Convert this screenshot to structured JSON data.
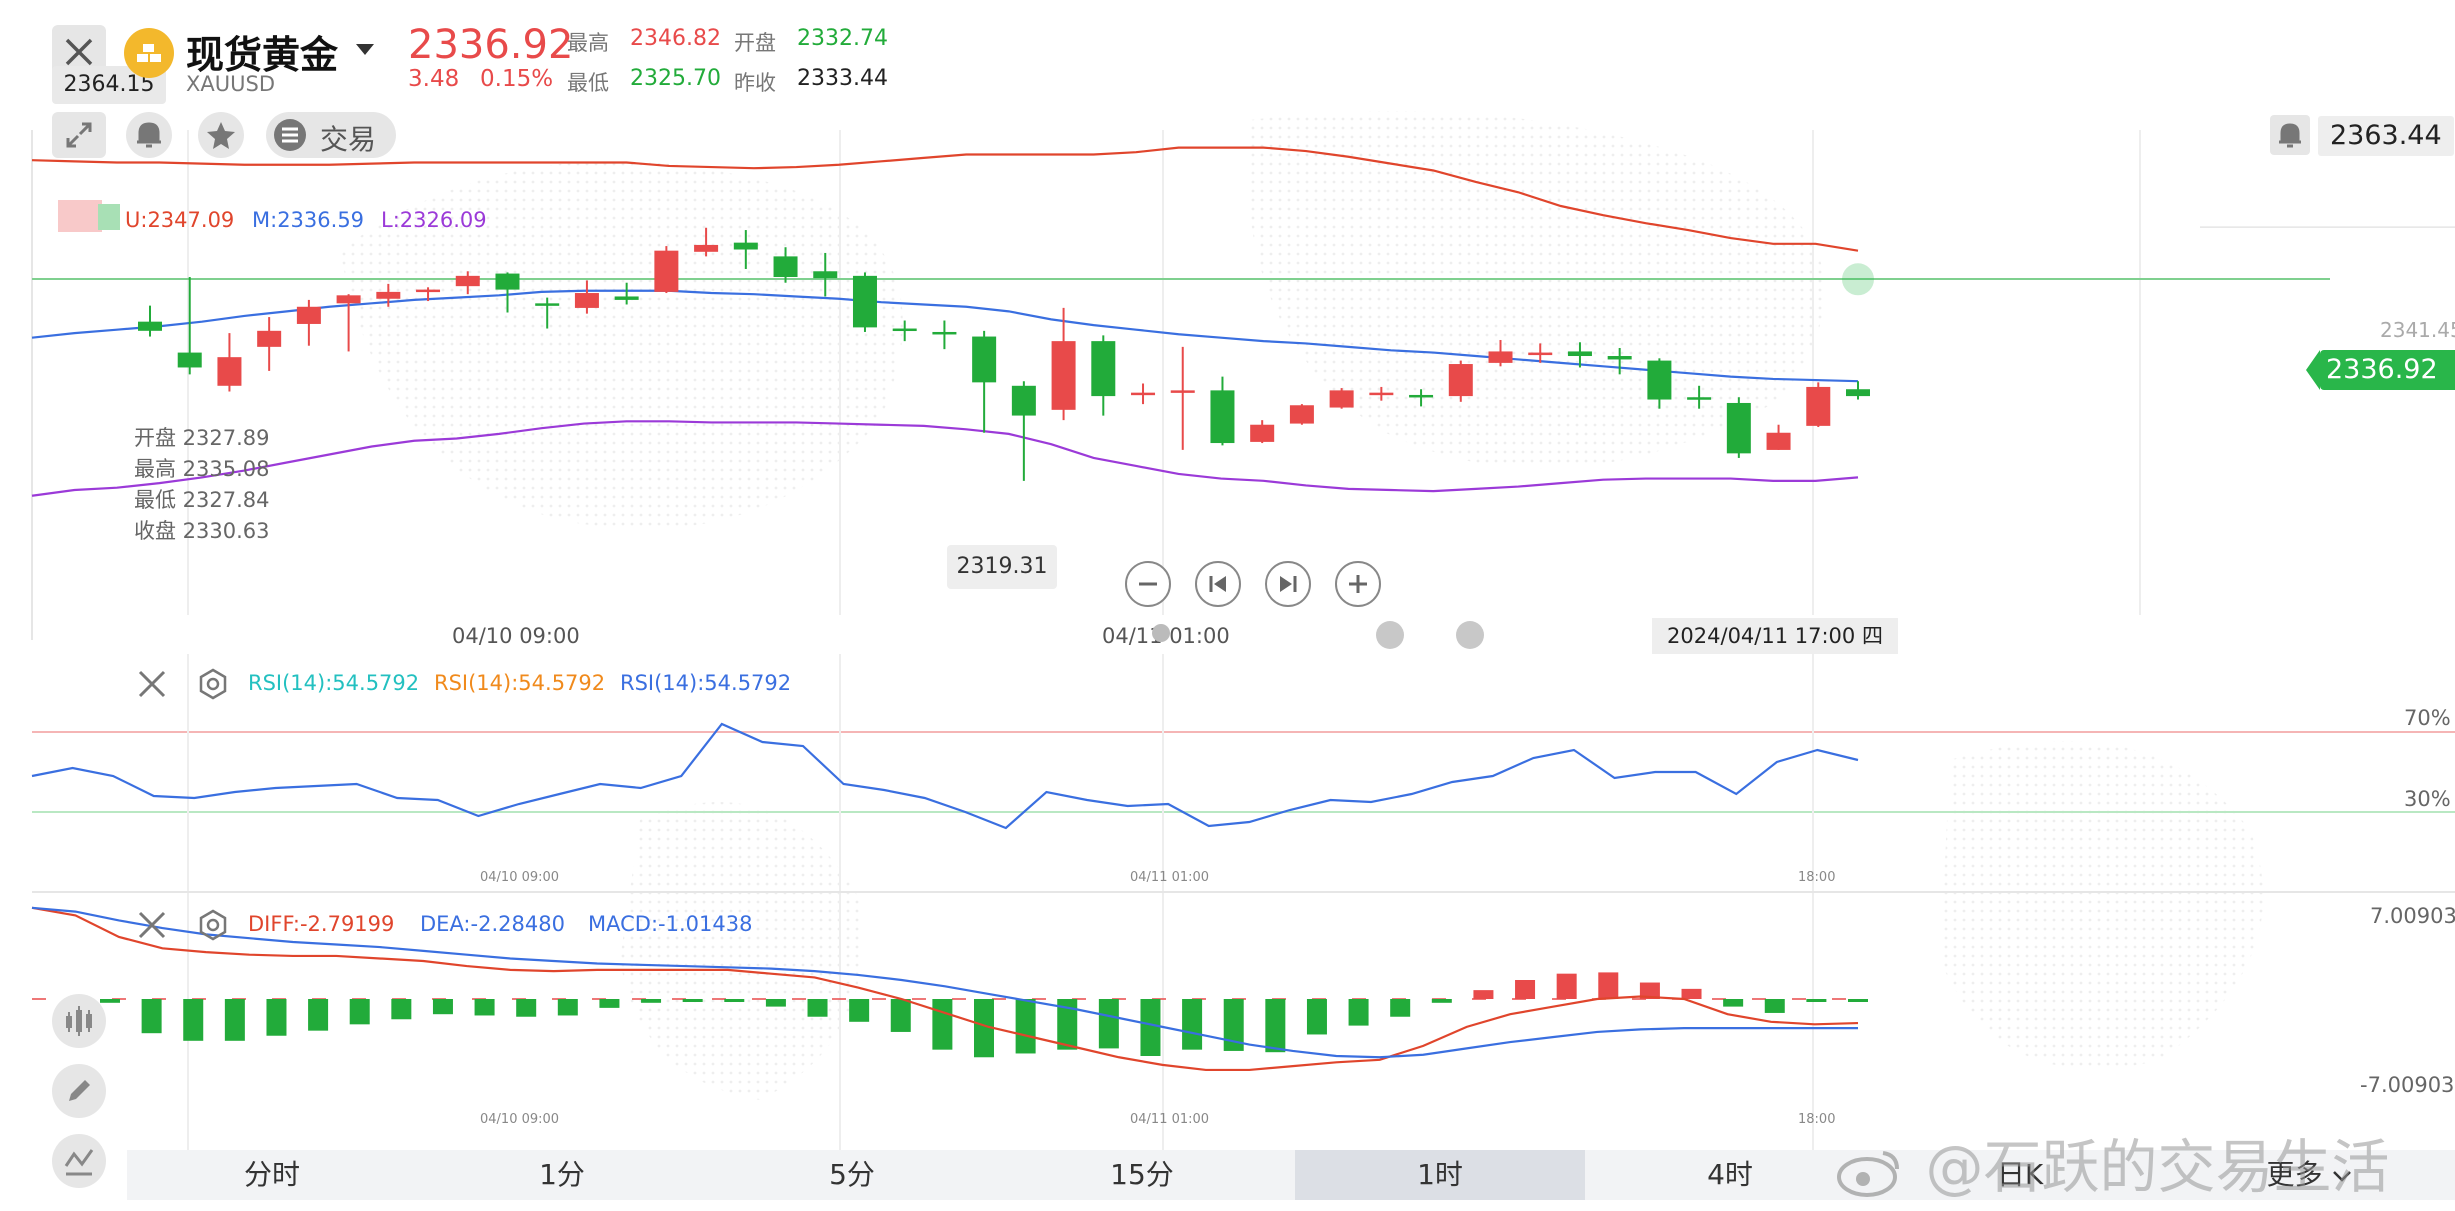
{
  "header": {
    "title": "现货黄金",
    "symbol": "XAUUSD",
    "price": "2336.92",
    "change": "3.48",
    "change_pct": "0.15%",
    "high_label": "最高",
    "high_value": "2346.82",
    "open_label": "开盘",
    "open_value": "2332.74",
    "low_label": "最低",
    "low_value": "2325.70",
    "prev_close_label": "昨收",
    "prev_close_value": "2333.44",
    "trade_label": "交易",
    "close_icon": "close-icon",
    "logo_icon": "gold-bars-icon",
    "dropdown_icon": "caret-down-icon"
  },
  "main_chart": {
    "top_price_tag": "2364.15",
    "alert_price": "2363.44",
    "current_price_tag": "2336.92",
    "right_axis_label": "2341.45",
    "low_marker": "2319.31",
    "boll": {
      "upper": "U:2347.09",
      "middle": "M:2336.59",
      "lower": "L:2326.09"
    },
    "ohlc_popup": {
      "open": "开盘 2327.89",
      "high": "最高 2335.08",
      "low": "最低 2327.84",
      "close": "收盘 2330.63"
    },
    "time_labels": [
      "04/10 09:00",
      "04/11 01:00"
    ],
    "crosshair_time": "2024/04/11 17:00 四",
    "colors": {
      "up": "#e84a4a",
      "down": "#22ab3a",
      "upper": "#e0452c",
      "middle": "#3a6fe0",
      "lower": "#9b3ad8"
    }
  },
  "rsi_panel": {
    "rsi1": "RSI(14):54.5792",
    "rsi2": "RSI(14):54.5792",
    "rsi3": "RSI(14):54.5792",
    "level_70": "70%",
    "level_30": "30%",
    "time_labels": [
      "04/10 09:00",
      "04/11 01:00",
      "18:00"
    ]
  },
  "macd_panel": {
    "diff": "DIFF:-2.79199",
    "dea": "DEA:-2.28480",
    "macd": "MACD:-1.01438",
    "axis_top": "7.00903",
    "axis_bottom": "-7.00903",
    "time_labels": [
      "04/10 09:00",
      "04/11 01:00",
      "18:00"
    ]
  },
  "tabs": [
    "分时",
    "1分",
    "5分",
    "15分",
    "1时",
    "4时",
    "日K",
    "更多"
  ],
  "active_tab": "1时",
  "watermark": "@石跃的交易生活",
  "chart_data": {
    "type": "candlestick",
    "candles": [
      {
        "o": 2333.2,
        "h": 2334.6,
        "c": 2332.4,
        "l": 2331.9
      },
      {
        "o": 2330.5,
        "h": 2337.1,
        "c": 2329.2,
        "l": 2328.6
      },
      {
        "o": 2327.6,
        "h": 2332.2,
        "c": 2330.1,
        "l": 2327.1
      },
      {
        "o": 2331.0,
        "h": 2333.6,
        "c": 2332.4,
        "l": 2328.9
      },
      {
        "o": 2333.0,
        "h": 2335.1,
        "c": 2334.5,
        "l": 2331.1
      },
      {
        "o": 2334.8,
        "h": 2335.6,
        "c": 2335.5,
        "l": 2330.6
      },
      {
        "o": 2335.2,
        "h": 2336.5,
        "c": 2335.8,
        "l": 2334.5
      },
      {
        "o": 2335.9,
        "h": 2336.2,
        "c": 2336.0,
        "l": 2335.0
      },
      {
        "o": 2336.3,
        "h": 2337.6,
        "c": 2337.2,
        "l": 2335.6
      },
      {
        "o": 2337.4,
        "h": 2337.5,
        "c": 2336.0,
        "l": 2334.0
      },
      {
        "o": 2334.8,
        "h": 2335.3,
        "c": 2334.7,
        "l": 2332.6
      },
      {
        "o": 2334.4,
        "h": 2336.8,
        "c": 2335.7,
        "l": 2333.9
      },
      {
        "o": 2335.4,
        "h": 2336.6,
        "c": 2335.1,
        "l": 2334.7
      },
      {
        "o": 2335.8,
        "h": 2339.8,
        "c": 2339.4,
        "l": 2335.7
      },
      {
        "o": 2339.3,
        "h": 2341.4,
        "c": 2339.9,
        "l": 2338.9
      },
      {
        "o": 2340.1,
        "h": 2341.2,
        "c": 2339.5,
        "l": 2337.8
      },
      {
        "o": 2338.9,
        "h": 2339.7,
        "c": 2337.1,
        "l": 2336.6
      },
      {
        "o": 2337.6,
        "h": 2339.2,
        "c": 2337.0,
        "l": 2335.4
      },
      {
        "o": 2337.2,
        "h": 2337.5,
        "c": 2332.7,
        "l": 2332.3
      },
      {
        "o": 2332.6,
        "h": 2333.3,
        "c": 2332.5,
        "l": 2331.5
      },
      {
        "o": 2332.3,
        "h": 2333.3,
        "c": 2332.1,
        "l": 2330.8
      },
      {
        "o": 2331.9,
        "h": 2332.4,
        "c": 2327.9,
        "l": 2323.5
      },
      {
        "o": 2327.6,
        "h": 2328.0,
        "c": 2325.0,
        "l": 2319.3
      },
      {
        "o": 2325.5,
        "h": 2334.4,
        "c": 2331.5,
        "l": 2324.6
      },
      {
        "o": 2331.5,
        "h": 2332.0,
        "c": 2326.7,
        "l": 2325.0
      },
      {
        "o": 2327.0,
        "h": 2327.8,
        "c": 2327.0,
        "l": 2326.0
      },
      {
        "o": 2327.0,
        "h": 2331.0,
        "c": 2327.2,
        "l": 2322.0
      },
      {
        "o": 2327.2,
        "h": 2328.4,
        "c": 2322.6,
        "l": 2322.4
      },
      {
        "o": 2322.7,
        "h": 2324.6,
        "c": 2324.2,
        "l": 2322.6
      },
      {
        "o": 2324.3,
        "h": 2326.0,
        "c": 2325.9,
        "l": 2324.2
      },
      {
        "o": 2325.7,
        "h": 2327.4,
        "c": 2327.2,
        "l": 2325.6
      },
      {
        "o": 2327.0,
        "h": 2327.5,
        "c": 2327.0,
        "l": 2326.3
      },
      {
        "o": 2326.8,
        "h": 2327.3,
        "c": 2326.7,
        "l": 2325.8
      },
      {
        "o": 2326.7,
        "h": 2329.8,
        "c": 2329.5,
        "l": 2326.2
      },
      {
        "o": 2329.6,
        "h": 2331.6,
        "c": 2330.6,
        "l": 2329.3
      },
      {
        "o": 2330.4,
        "h": 2331.3,
        "c": 2330.5,
        "l": 2329.6
      },
      {
        "o": 2330.6,
        "h": 2331.4,
        "c": 2330.2,
        "l": 2329.2
      },
      {
        "o": 2330.2,
        "h": 2330.9,
        "c": 2329.9,
        "l": 2328.6
      },
      {
        "o": 2329.8,
        "h": 2330.0,
        "c": 2326.4,
        "l": 2325.6
      },
      {
        "o": 2326.6,
        "h": 2327.6,
        "c": 2326.4,
        "l": 2325.6
      },
      {
        "o": 2326.1,
        "h": 2326.6,
        "c": 2321.7,
        "l": 2321.3
      },
      {
        "o": 2322.0,
        "h": 2324.2,
        "c": 2323.5,
        "l": 2322.0
      },
      {
        "o": 2324.1,
        "h": 2327.9,
        "c": 2327.5,
        "l": 2324.0
      },
      {
        "o": 2327.3,
        "h": 2328.0,
        "c": 2326.7,
        "l": 2326.4
      }
    ],
    "boll_upper": [
      2347.3,
      2347.2,
      2347.1,
      2347.1,
      2347.0,
      2346.9,
      2346.9,
      2346.9,
      2347.0,
      2347.1,
      2347.1,
      2347.1,
      2347.1,
      2347.1,
      2347.1,
      2346.8,
      2346.7,
      2346.6,
      2346.7,
      2346.9,
      2347.2,
      2347.5,
      2347.8,
      2347.8,
      2347.8,
      2347.8,
      2348.0,
      2348.4,
      2348.4,
      2348.4,
      2348.1,
      2347.6,
      2347.0,
      2346.4,
      2345.4,
      2344.5,
      2343.3,
      2342.5,
      2341.8,
      2341.2,
      2340.5,
      2340.0,
      2340.0,
      2339.4
    ],
    "boll_mid": [
      2331.8,
      2332.2,
      2332.5,
      2332.8,
      2333.2,
      2333.7,
      2334.1,
      2334.5,
      2334.8,
      2335.1,
      2335.3,
      2335.5,
      2335.8,
      2335.9,
      2335.9,
      2335.9,
      2335.7,
      2335.6,
      2335.4,
      2335.2,
      2334.9,
      2334.7,
      2334.5,
      2334.1,
      2333.4,
      2332.9,
      2332.5,
      2332.1,
      2331.8,
      2331.5,
      2331.3,
      2331.0,
      2330.7,
      2330.5,
      2330.2,
      2329.9,
      2329.6,
      2329.3,
      2329.0,
      2328.7,
      2328.4,
      2328.2,
      2328.1,
      2328.0
    ],
    "boll_lower": [
      2318.0,
      2318.5,
      2318.7,
      2319.1,
      2319.6,
      2320.2,
      2320.9,
      2321.6,
      2322.3,
      2322.8,
      2323.0,
      2323.4,
      2323.9,
      2324.3,
      2324.5,
      2324.5,
      2324.4,
      2324.4,
      2324.4,
      2324.3,
      2324.2,
      2324.1,
      2323.8,
      2323.4,
      2322.5,
      2321.3,
      2320.6,
      2319.9,
      2319.5,
      2319.3,
      2318.9,
      2318.6,
      2318.5,
      2318.4,
      2318.6,
      2318.8,
      2319.1,
      2319.4,
      2319.5,
      2319.5,
      2319.5,
      2319.3,
      2319.3,
      2319.6
    ],
    "rsi": [
      48,
      52,
      48,
      38,
      37,
      40,
      42,
      43,
      44,
      37,
      36,
      28,
      34,
      39,
      44,
      42,
      48,
      74,
      65,
      63,
      44,
      41,
      37,
      30,
      22,
      40,
      36,
      33,
      34,
      23,
      25,
      31,
      36,
      35,
      39,
      45,
      48,
      57,
      61,
      47,
      50,
      50,
      39,
      55,
      61,
      56
    ],
    "macd_hist": [
      -0.3,
      -2.7,
      -3.3,
      -3.3,
      -2.9,
      -2.5,
      -2.0,
      -1.6,
      -1.2,
      -1.3,
      -1.4,
      -1.3,
      -0.7,
      -0.3,
      -0.1,
      -0.2,
      -0.6,
      -1.4,
      -1.8,
      -2.6,
      -4.0,
      -4.6,
      -4.3,
      -4.0,
      -3.9,
      -4.5,
      -4.0,
      -4.1,
      -4.2,
      -2.8,
      -2.1,
      -1.4,
      -0.3,
      0.7,
      1.5,
      2.0,
      2.1,
      1.3,
      0.8,
      -0.6,
      -1.1,
      -0.1,
      -0.1
    ],
    "macd_diff": [
      7.2,
      6.6,
      4.9,
      4.0,
      3.7,
      3.5,
      3.4,
      3.4,
      3.2,
      3.0,
      2.6,
      2.3,
      2.2,
      2.3,
      2.3,
      2.3,
      2.3,
      2.0,
      1.7,
      0.9,
      0.0,
      -1.1,
      -2.2,
      -3.0,
      -3.8,
      -4.6,
      -5.2,
      -5.6,
      -5.6,
      -5.3,
      -5.0,
      -4.8,
      -3.7,
      -2.2,
      -1.2,
      -0.6,
      0.0,
      0.2,
      0.0,
      -1.2,
      -1.8,
      -2.0,
      -1.9
    ],
    "macd_dea": [
      7.2,
      6.9,
      6.2,
      5.6,
      5.1,
      4.8,
      4.5,
      4.3,
      4.1,
      3.8,
      3.5,
      3.2,
      3.0,
      2.8,
      2.7,
      2.6,
      2.5,
      2.4,
      2.2,
      1.9,
      1.5,
      1.0,
      0.4,
      -0.2,
      -0.8,
      -1.5,
      -2.2,
      -2.9,
      -3.6,
      -4.1,
      -4.5,
      -4.6,
      -4.4,
      -3.9,
      -3.4,
      -3.0,
      -2.6,
      -2.4,
      -2.3,
      -2.3,
      -2.3,
      -2.3,
      -2.3
    ]
  }
}
